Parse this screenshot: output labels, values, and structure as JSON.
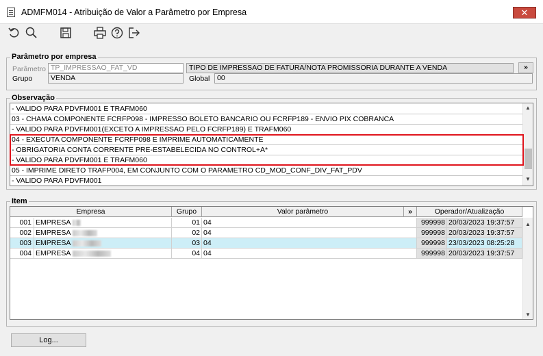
{
  "window": {
    "title": "ADMFM014 - Atribuição de Valor a Parâmetro por Empresa",
    "close_glyph": "✕"
  },
  "toolbar": {
    "icons": [
      "undo-icon",
      "search-icon",
      "save-icon",
      "print-icon",
      "help-icon",
      "exit-icon"
    ]
  },
  "param_group": {
    "label": "Parâmetro por empresa",
    "parametro_label": "Parâmetro",
    "parametro_value": "TP_IMPRESSAO_FAT_VD",
    "descricao": "TIPO DE IMPRESSAO DE FATURA/NOTA PROMISSORIA DURANTE A VENDA",
    "more_button": "»",
    "grupo_label": "Grupo",
    "grupo_value": "VENDA",
    "global_label": "Global",
    "global_value": "00"
  },
  "observacao": {
    "label": "Observação",
    "lines": [
      "   - VALIDO PARA PDVFM001 E TRAFM060",
      "03 - CHAMA COMPONENTE FCRFP098 - IMPRESSO BOLETO BANCARIO OU FCRFP189 - ENVIO PIX COBRANCA",
      "   - VALIDO PARA PDVFM001(EXCETO A IMPRESSAO PELO FCRFP189) E TRAFM060",
      "04 - EXECUTA COMPONENTE FCRFP098 E IMPRIME AUTOMATICAMENTE",
      "   - OBRIGATORIA CONTA CORRENTE PRE-ESTABELECIDA NO CONTROL+A*",
      "   - VALIDO PARA PDVFM001 E TRAFM060",
      "05 - IMPRIME DIRETO TRAFP004, EM CONJUNTO COM O PARAMETRO CD_MOD_CONF_DIV_FAT_PDV",
      "   - VALIDO PARA PDVFM001"
    ]
  },
  "item": {
    "label": "Item",
    "headers": {
      "empresa": "Empresa",
      "grupo": "Grupo",
      "valor": "Valor parâmetro",
      "more": "»",
      "operador": "Operador/Atualização"
    },
    "rows": [
      {
        "code": "001",
        "empresa": "EMPRESA",
        "grupo": "01",
        "valor": "04",
        "operador": "999998",
        "data": "20/03/2023 19:37:57"
      },
      {
        "code": "002",
        "empresa": "EMPRESA",
        "grupo": "02",
        "valor": "04",
        "operador": "999998",
        "data": "20/03/2023 19:37:57"
      },
      {
        "code": "003",
        "empresa": "EMPRESA",
        "grupo": "03",
        "valor": "04",
        "operador": "999998",
        "data": "23/03/2023 08:25:28"
      },
      {
        "code": "004",
        "empresa": "EMPRESA",
        "grupo": "04",
        "valor": "04",
        "operador": "999998",
        "data": "20/03/2023 19:37:57"
      }
    ]
  },
  "log_button": "Log..."
}
